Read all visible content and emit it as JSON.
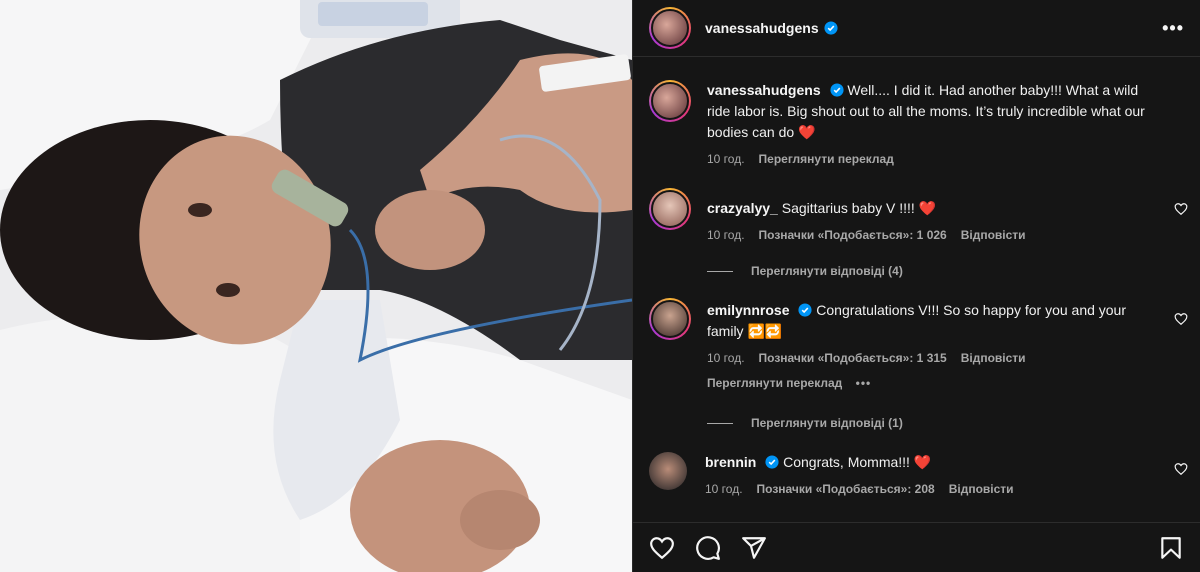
{
  "post": {
    "author": "vanessahudgens",
    "caption_user": "vanessahudgens",
    "caption": "Well.... I did it. Had another baby!!! What a wild ride labor is. Big shout out to all the moms. It’s truly incredible what our bodies can do",
    "caption_emoji": "❤️",
    "time": "10 год.",
    "translate_label": "Переглянути переклад"
  },
  "comments": [
    {
      "user": "crazyalyy_",
      "verified": false,
      "text": "Sagittarius baby V !!!!",
      "emoji": "❤️",
      "time": "10 год.",
      "likes": "Позначки «Подобається»: 1 026",
      "reply": "Відповісти",
      "view_replies": "Переглянути відповіді (4)"
    },
    {
      "user": "emilynnrose",
      "verified": true,
      "text": "Congratulations V!!! So so happy for you and your family",
      "emoji": "🔁🔁",
      "time": "10 год.",
      "likes": "Позначки «Подобається»: 1 315",
      "reply": "Відповісти",
      "translate": "Переглянути переклад",
      "more": "•••",
      "view_replies": "Переглянути відповіді (1)"
    },
    {
      "user": "brennin",
      "verified": true,
      "text": "Congrats, Momma!!!",
      "emoji": "❤️",
      "time": "10 год.",
      "likes": "Позначки «Подобається»: 208",
      "reply": "Відповісти"
    }
  ],
  "icons": {
    "more": "more-options-icon",
    "like": "heart-icon",
    "comment": "comment-icon",
    "share": "share-icon",
    "save": "bookmark-icon",
    "verified": "verified-badge-icon"
  },
  "colors": {
    "background": "#151515",
    "verified": "#0095f6",
    "muted": "#a8a8a8",
    "heart": "#e0245e"
  }
}
